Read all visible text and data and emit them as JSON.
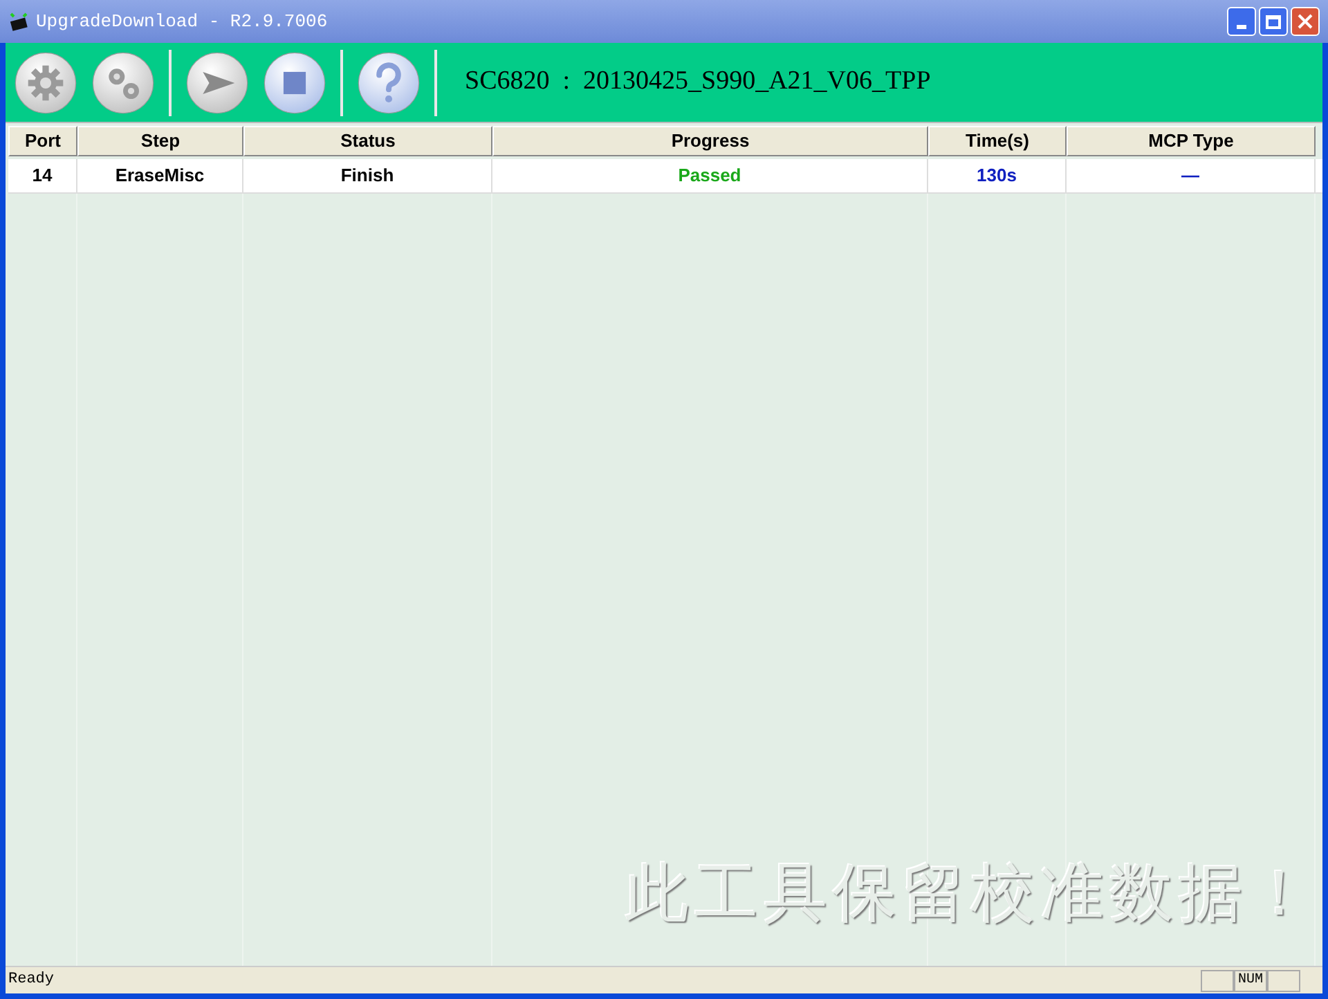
{
  "window": {
    "title": "UpgradeDownload - R2.9.7006"
  },
  "toolbar": {
    "buttons": [
      {
        "kind": "gear"
      },
      {
        "kind": "gears"
      },
      {
        "kind": "start"
      },
      {
        "kind": "stop"
      },
      {
        "kind": "help"
      }
    ],
    "info": "SC6820  :  20130425_S990_A21_V06_TPP"
  },
  "table": {
    "columns": [
      "Port",
      "Step",
      "Status",
      "Progress",
      "Time(s)",
      "MCP Type"
    ],
    "rows": [
      {
        "port": "14",
        "step": "EraseMisc",
        "status": "Finish",
        "progress": "Passed",
        "time": "130s",
        "mcp_type": "—"
      }
    ]
  },
  "annotation": "此工具保留校准数据！",
  "status_bar": {
    "text": "Ready",
    "indicator": "NUM"
  }
}
